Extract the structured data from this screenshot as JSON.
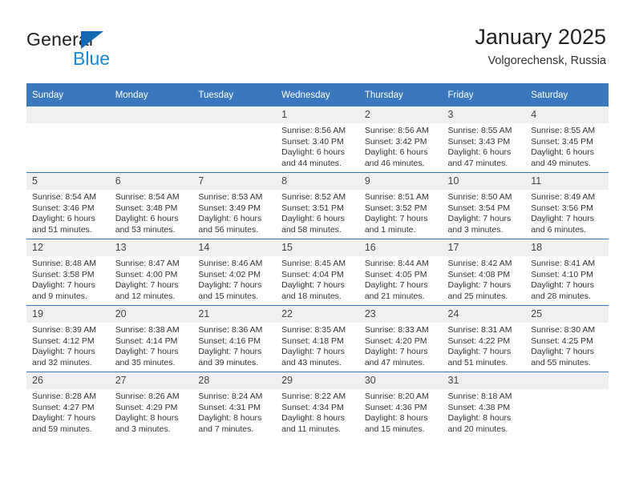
{
  "brand": {
    "name_part1": "General",
    "name_part2": "Blue",
    "logo_icon": "triangle-icon"
  },
  "header": {
    "title": "January 2025",
    "subtitle": "Volgorechensk, Russia"
  },
  "weekdays": [
    "Sunday",
    "Monday",
    "Tuesday",
    "Wednesday",
    "Thursday",
    "Friday",
    "Saturday"
  ],
  "labels": {
    "sunrise": "Sunrise:",
    "sunset": "Sunset:",
    "daylight": "Daylight:"
  },
  "colors": {
    "header_blue": "#3b77bc",
    "brand_blue": "#1a87d8",
    "logo_triangle_blue": "#1268b3",
    "daynum_background": "#f0f0f0",
    "text": "#333333"
  },
  "weeks": [
    [
      {
        "day": "",
        "empty": true,
        "sunrise": "",
        "sunset": "",
        "daylight_line1": "",
        "daylight_line2": ""
      },
      {
        "day": "",
        "empty": true,
        "sunrise": "",
        "sunset": "",
        "daylight_line1": "",
        "daylight_line2": ""
      },
      {
        "day": "",
        "empty": true,
        "sunrise": "",
        "sunset": "",
        "daylight_line1": "",
        "daylight_line2": ""
      },
      {
        "day": "1",
        "empty": false,
        "sunrise": "Sunrise: 8:56 AM",
        "sunset": "Sunset: 3:40 PM",
        "daylight_line1": "Daylight: 6 hours",
        "daylight_line2": "and 44 minutes."
      },
      {
        "day": "2",
        "empty": false,
        "sunrise": "Sunrise: 8:56 AM",
        "sunset": "Sunset: 3:42 PM",
        "daylight_line1": "Daylight: 6 hours",
        "daylight_line2": "and 46 minutes."
      },
      {
        "day": "3",
        "empty": false,
        "sunrise": "Sunrise: 8:55 AM",
        "sunset": "Sunset: 3:43 PM",
        "daylight_line1": "Daylight: 6 hours",
        "daylight_line2": "and 47 minutes."
      },
      {
        "day": "4",
        "empty": false,
        "sunrise": "Sunrise: 8:55 AM",
        "sunset": "Sunset: 3:45 PM",
        "daylight_line1": "Daylight: 6 hours",
        "daylight_line2": "and 49 minutes."
      }
    ],
    [
      {
        "day": "5",
        "empty": false,
        "sunrise": "Sunrise: 8:54 AM",
        "sunset": "Sunset: 3:46 PM",
        "daylight_line1": "Daylight: 6 hours",
        "daylight_line2": "and 51 minutes."
      },
      {
        "day": "6",
        "empty": false,
        "sunrise": "Sunrise: 8:54 AM",
        "sunset": "Sunset: 3:48 PM",
        "daylight_line1": "Daylight: 6 hours",
        "daylight_line2": "and 53 minutes."
      },
      {
        "day": "7",
        "empty": false,
        "sunrise": "Sunrise: 8:53 AM",
        "sunset": "Sunset: 3:49 PM",
        "daylight_line1": "Daylight: 6 hours",
        "daylight_line2": "and 56 minutes."
      },
      {
        "day": "8",
        "empty": false,
        "sunrise": "Sunrise: 8:52 AM",
        "sunset": "Sunset: 3:51 PM",
        "daylight_line1": "Daylight: 6 hours",
        "daylight_line2": "and 58 minutes."
      },
      {
        "day": "9",
        "empty": false,
        "sunrise": "Sunrise: 8:51 AM",
        "sunset": "Sunset: 3:52 PM",
        "daylight_line1": "Daylight: 7 hours",
        "daylight_line2": "and 1 minute."
      },
      {
        "day": "10",
        "empty": false,
        "sunrise": "Sunrise: 8:50 AM",
        "sunset": "Sunset: 3:54 PM",
        "daylight_line1": "Daylight: 7 hours",
        "daylight_line2": "and 3 minutes."
      },
      {
        "day": "11",
        "empty": false,
        "sunrise": "Sunrise: 8:49 AM",
        "sunset": "Sunset: 3:56 PM",
        "daylight_line1": "Daylight: 7 hours",
        "daylight_line2": "and 6 minutes."
      }
    ],
    [
      {
        "day": "12",
        "empty": false,
        "sunrise": "Sunrise: 8:48 AM",
        "sunset": "Sunset: 3:58 PM",
        "daylight_line1": "Daylight: 7 hours",
        "daylight_line2": "and 9 minutes."
      },
      {
        "day": "13",
        "empty": false,
        "sunrise": "Sunrise: 8:47 AM",
        "sunset": "Sunset: 4:00 PM",
        "daylight_line1": "Daylight: 7 hours",
        "daylight_line2": "and 12 minutes."
      },
      {
        "day": "14",
        "empty": false,
        "sunrise": "Sunrise: 8:46 AM",
        "sunset": "Sunset: 4:02 PM",
        "daylight_line1": "Daylight: 7 hours",
        "daylight_line2": "and 15 minutes."
      },
      {
        "day": "15",
        "empty": false,
        "sunrise": "Sunrise: 8:45 AM",
        "sunset": "Sunset: 4:04 PM",
        "daylight_line1": "Daylight: 7 hours",
        "daylight_line2": "and 18 minutes."
      },
      {
        "day": "16",
        "empty": false,
        "sunrise": "Sunrise: 8:44 AM",
        "sunset": "Sunset: 4:05 PM",
        "daylight_line1": "Daylight: 7 hours",
        "daylight_line2": "and 21 minutes."
      },
      {
        "day": "17",
        "empty": false,
        "sunrise": "Sunrise: 8:42 AM",
        "sunset": "Sunset: 4:08 PM",
        "daylight_line1": "Daylight: 7 hours",
        "daylight_line2": "and 25 minutes."
      },
      {
        "day": "18",
        "empty": false,
        "sunrise": "Sunrise: 8:41 AM",
        "sunset": "Sunset: 4:10 PM",
        "daylight_line1": "Daylight: 7 hours",
        "daylight_line2": "and 28 minutes."
      }
    ],
    [
      {
        "day": "19",
        "empty": false,
        "sunrise": "Sunrise: 8:39 AM",
        "sunset": "Sunset: 4:12 PM",
        "daylight_line1": "Daylight: 7 hours",
        "daylight_line2": "and 32 minutes."
      },
      {
        "day": "20",
        "empty": false,
        "sunrise": "Sunrise: 8:38 AM",
        "sunset": "Sunset: 4:14 PM",
        "daylight_line1": "Daylight: 7 hours",
        "daylight_line2": "and 35 minutes."
      },
      {
        "day": "21",
        "empty": false,
        "sunrise": "Sunrise: 8:36 AM",
        "sunset": "Sunset: 4:16 PM",
        "daylight_line1": "Daylight: 7 hours",
        "daylight_line2": "and 39 minutes."
      },
      {
        "day": "22",
        "empty": false,
        "sunrise": "Sunrise: 8:35 AM",
        "sunset": "Sunset: 4:18 PM",
        "daylight_line1": "Daylight: 7 hours",
        "daylight_line2": "and 43 minutes."
      },
      {
        "day": "23",
        "empty": false,
        "sunrise": "Sunrise: 8:33 AM",
        "sunset": "Sunset: 4:20 PM",
        "daylight_line1": "Daylight: 7 hours",
        "daylight_line2": "and 47 minutes."
      },
      {
        "day": "24",
        "empty": false,
        "sunrise": "Sunrise: 8:31 AM",
        "sunset": "Sunset: 4:22 PM",
        "daylight_line1": "Daylight: 7 hours",
        "daylight_line2": "and 51 minutes."
      },
      {
        "day": "25",
        "empty": false,
        "sunrise": "Sunrise: 8:30 AM",
        "sunset": "Sunset: 4:25 PM",
        "daylight_line1": "Daylight: 7 hours",
        "daylight_line2": "and 55 minutes."
      }
    ],
    [
      {
        "day": "26",
        "empty": false,
        "sunrise": "Sunrise: 8:28 AM",
        "sunset": "Sunset: 4:27 PM",
        "daylight_line1": "Daylight: 7 hours",
        "daylight_line2": "and 59 minutes."
      },
      {
        "day": "27",
        "empty": false,
        "sunrise": "Sunrise: 8:26 AM",
        "sunset": "Sunset: 4:29 PM",
        "daylight_line1": "Daylight: 8 hours",
        "daylight_line2": "and 3 minutes."
      },
      {
        "day": "28",
        "empty": false,
        "sunrise": "Sunrise: 8:24 AM",
        "sunset": "Sunset: 4:31 PM",
        "daylight_line1": "Daylight: 8 hours",
        "daylight_line2": "and 7 minutes."
      },
      {
        "day": "29",
        "empty": false,
        "sunrise": "Sunrise: 8:22 AM",
        "sunset": "Sunset: 4:34 PM",
        "daylight_line1": "Daylight: 8 hours",
        "daylight_line2": "and 11 minutes."
      },
      {
        "day": "30",
        "empty": false,
        "sunrise": "Sunrise: 8:20 AM",
        "sunset": "Sunset: 4:36 PM",
        "daylight_line1": "Daylight: 8 hours",
        "daylight_line2": "and 15 minutes."
      },
      {
        "day": "31",
        "empty": false,
        "sunrise": "Sunrise: 8:18 AM",
        "sunset": "Sunset: 4:38 PM",
        "daylight_line1": "Daylight: 8 hours",
        "daylight_line2": "and 20 minutes."
      },
      {
        "day": "",
        "empty": true,
        "sunrise": "",
        "sunset": "",
        "daylight_line1": "",
        "daylight_line2": ""
      }
    ]
  ]
}
